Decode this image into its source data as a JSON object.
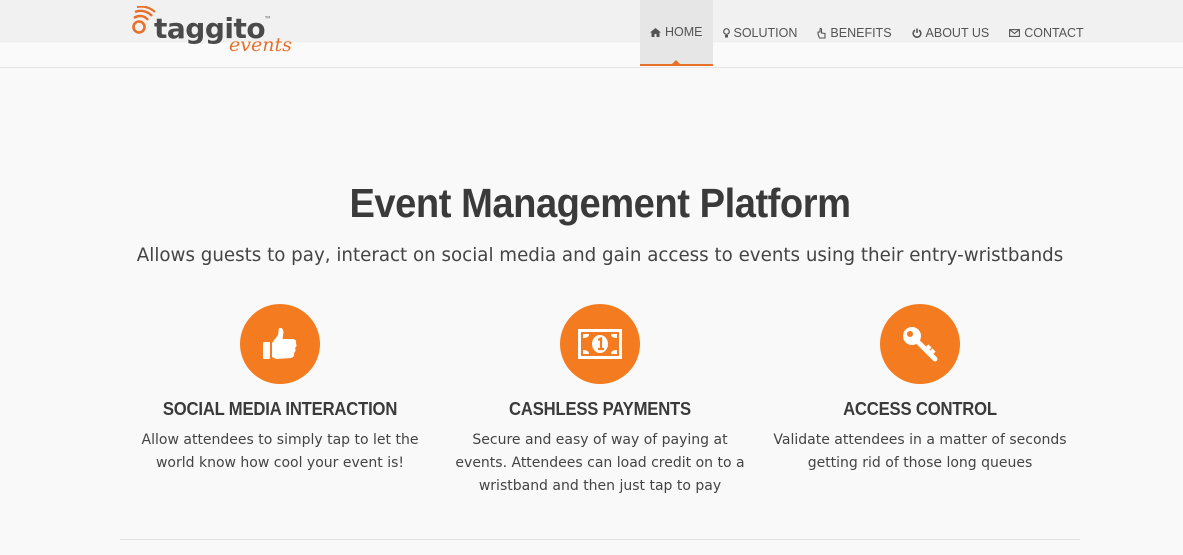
{
  "brand": {
    "name": "taggito",
    "trademark": "™",
    "subname": "events",
    "accent_color": "#f47b20"
  },
  "nav": {
    "items": [
      {
        "label": "HOME",
        "icon": "home-icon",
        "active": true
      },
      {
        "label": "SOLUTION",
        "icon": "lightbulb-icon",
        "active": false
      },
      {
        "label": "BENEFITS",
        "icon": "hand-pointer-icon",
        "active": false
      },
      {
        "label": "ABOUT US",
        "icon": "power-icon",
        "active": false
      },
      {
        "label": "CONTACT",
        "icon": "envelope-icon",
        "active": false
      }
    ]
  },
  "hero": {
    "title": "Event Management Platform",
    "subtitle": "Allows guests to pay, interact on social media and gain access to events using their entry-wristbands"
  },
  "features": [
    {
      "icon": "thumbs-up-icon",
      "title": "SOCIAL MEDIA INTERACTION",
      "description": "Allow attendees to simply tap to let the world know how cool your event is!"
    },
    {
      "icon": "money-icon",
      "title": "CASHLESS PAYMENTS",
      "description": "Secure and easy of way of paying at events. Attendees can load credit on to a wristband and then just tap to pay"
    },
    {
      "icon": "key-icon",
      "title": "ACCESS CONTROL",
      "description": "Validate attendees in a matter of seconds getting rid of those long queues"
    }
  ]
}
